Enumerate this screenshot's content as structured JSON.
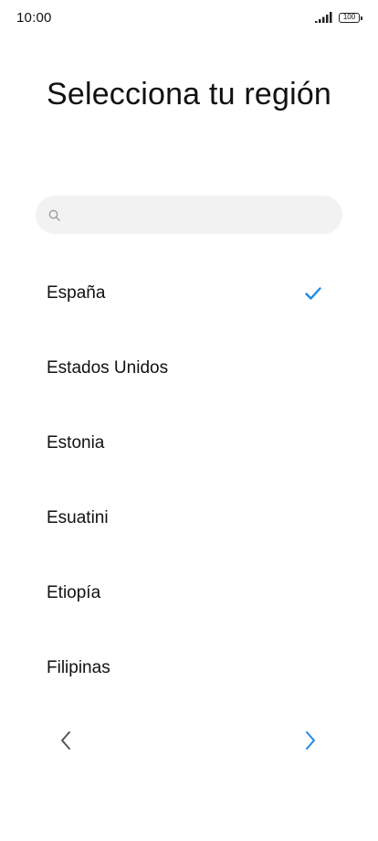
{
  "status_bar": {
    "time": "10:00",
    "battery": "100"
  },
  "title": "Selecciona tu región",
  "search": {
    "placeholder": ""
  },
  "regions": [
    {
      "name": "España",
      "selected": true
    },
    {
      "name": "Estados Unidos",
      "selected": false
    },
    {
      "name": "Estonia",
      "selected": false
    },
    {
      "name": "Esuatini",
      "selected": false
    },
    {
      "name": "Etiopía",
      "selected": false
    },
    {
      "name": "Filipinas",
      "selected": false
    }
  ],
  "icons": {
    "search": "search-icon",
    "check": "check-icon",
    "back": "chevron-left-icon",
    "next": "chevron-right-icon",
    "signal": "signal-icon",
    "battery": "battery-icon"
  },
  "colors": {
    "accent": "#1e88e5",
    "back_arrow": "#555555",
    "search_background": "#f2f2f2",
    "text": "#111111"
  }
}
